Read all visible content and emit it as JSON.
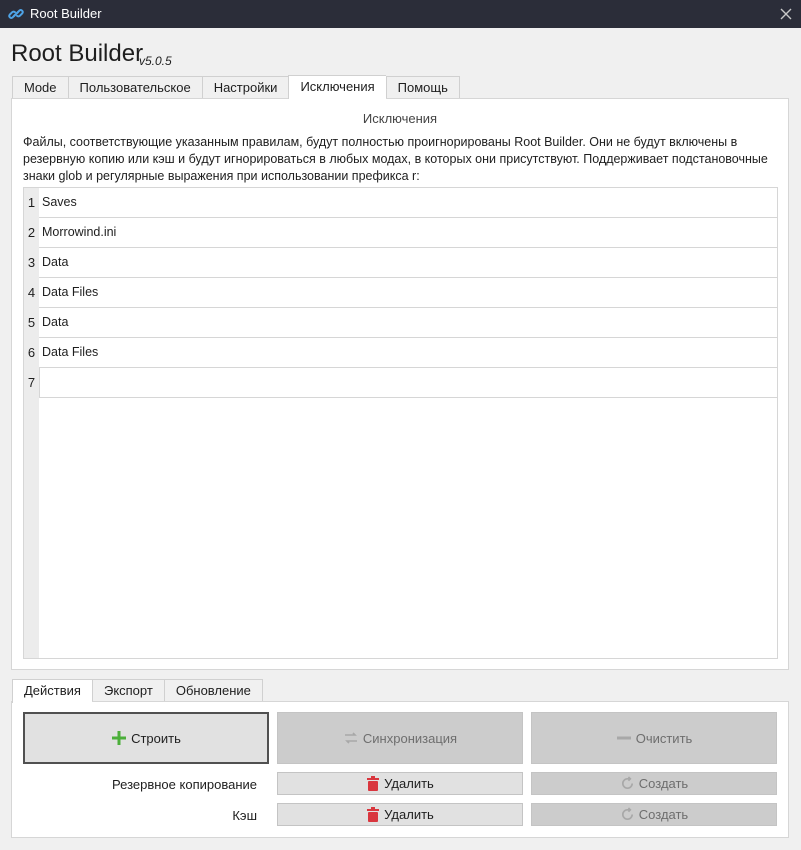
{
  "window": {
    "title": "Root Builder",
    "icon": "link-icon",
    "close_icon": "close-icon"
  },
  "header": {
    "app_name": "Root Builder",
    "version": "v5.0.5"
  },
  "tabs": [
    {
      "label": "Mode",
      "active": false
    },
    {
      "label": "Пользовательское",
      "active": false
    },
    {
      "label": "Настройки",
      "active": false
    },
    {
      "label": "Исключения",
      "active": true
    },
    {
      "label": "Помощь",
      "active": false
    }
  ],
  "exclusions": {
    "heading": "Исключения",
    "description": "Файлы, соответствующие указанным правилам, будут полностью проигнорированы Root Builder. Они не будут включены в резервную копию или кэш и будут игнорироваться в любых модах, в которых они присутствуют. Поддерживает подстановочные знаки glob и регулярные выражения при использовании префикса r:",
    "lines": [
      {
        "num": "1",
        "text": "Saves"
      },
      {
        "num": "2",
        "text": "Morrowind.ini"
      },
      {
        "num": "3",
        "text": "Data"
      },
      {
        "num": "4",
        "text": "Data Files"
      },
      {
        "num": "5",
        "text": "Data"
      },
      {
        "num": "6",
        "text": "Data Files"
      },
      {
        "num": "7",
        "text": ""
      }
    ]
  },
  "bottom_tabs": [
    {
      "label": "Действия",
      "active": true
    },
    {
      "label": "Экспорт",
      "active": false
    },
    {
      "label": "Обновление",
      "active": false
    }
  ],
  "actions": {
    "build_label": "Строить",
    "sync_label": "Синхронизация",
    "clear_label": "Очистить",
    "backup_label": "Резервное копирование",
    "backup_delete_label": "Удалить",
    "backup_create_label": "Создать",
    "cache_label": "Кэш",
    "cache_delete_label": "Удалить",
    "cache_create_label": "Создать"
  },
  "colors": {
    "titlebar": "#2b2d39",
    "build_icon": "#4caf3a",
    "delete_icon": "#d9363e",
    "disabled_text": "#6e6e6e"
  }
}
